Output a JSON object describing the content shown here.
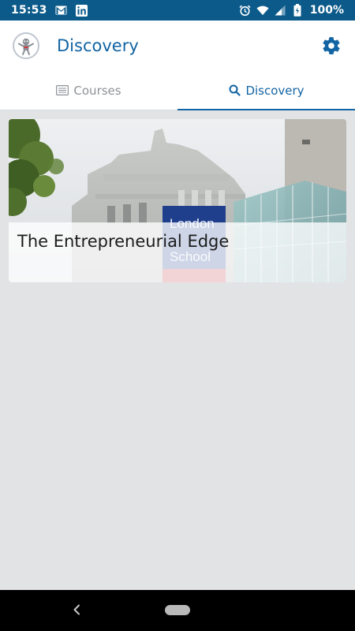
{
  "status_bar": {
    "time": "15:53",
    "battery": "100%",
    "icons": [
      "gmail-icon",
      "linkedin-icon",
      "alarm-icon",
      "wifi-icon",
      "signal-icon",
      "battery-icon"
    ]
  },
  "app_bar": {
    "title": "Discovery",
    "logo": "app-logo-icon",
    "settings_icon": "gear-icon"
  },
  "tabs": [
    {
      "label": "Courses",
      "icon": "list-icon",
      "active": false
    },
    {
      "label": "Discovery",
      "icon": "search-icon",
      "active": true
    }
  ],
  "cards": [
    {
      "title": "The Entrepreneurial Edge",
      "image_sign": "London School"
    }
  ],
  "colors": {
    "accent": "#1264a3",
    "status_bar": "#0b5a8a",
    "background": "#e2e3e5"
  }
}
